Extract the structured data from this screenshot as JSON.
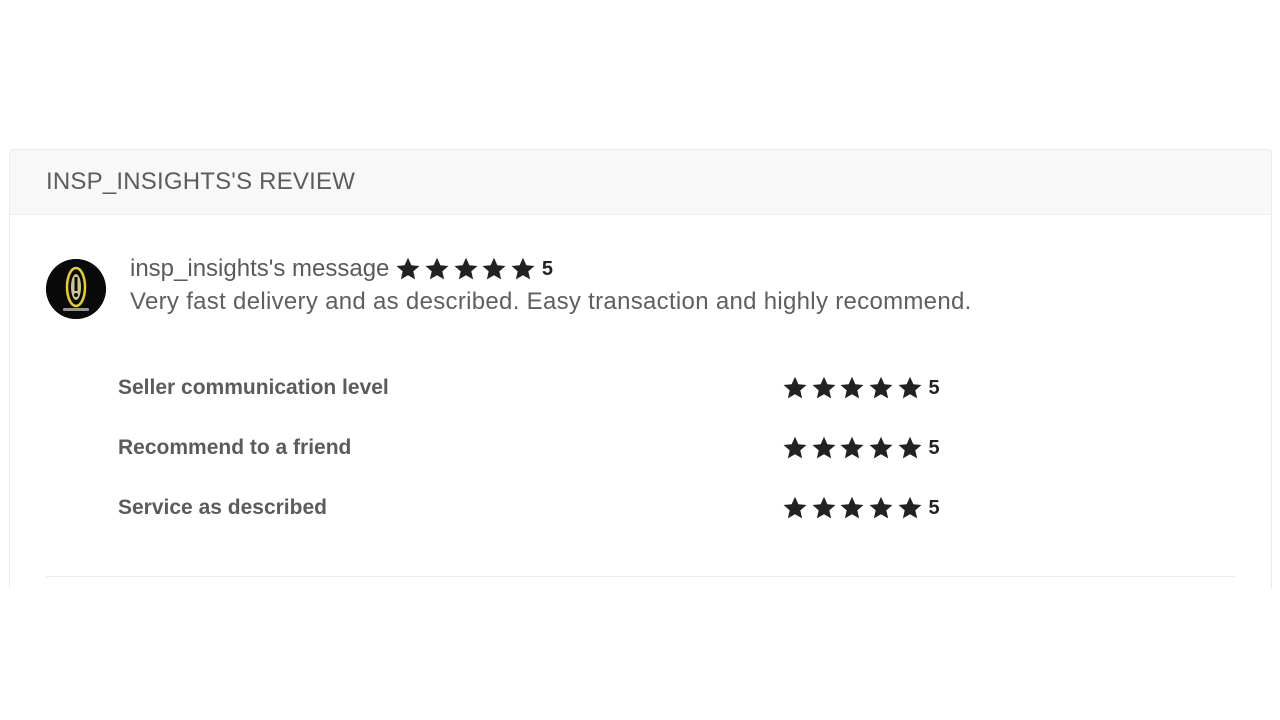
{
  "review": {
    "title": "INSP_INSIGHTS'S REVIEW",
    "reviewer_message_label": "insp_insights's message",
    "overall_rating": "5",
    "overall_stars": 5,
    "text": "Very fast delivery and as described. Easy transaction and highly recommend.",
    "avatar_icon": "user-avatar-icon"
  },
  "criteria": [
    {
      "label": "Seller communication level",
      "rating": "5",
      "stars": 5
    },
    {
      "label": "Recommend to a friend",
      "rating": "5",
      "stars": 5
    },
    {
      "label": "Service as described",
      "rating": "5",
      "stars": 5
    }
  ],
  "colors": {
    "star": "#222222",
    "header_bg": "#f8f8f8",
    "border": "#ececec",
    "text": "#5b5b5b",
    "avatar_ring": "#e8d21a"
  }
}
